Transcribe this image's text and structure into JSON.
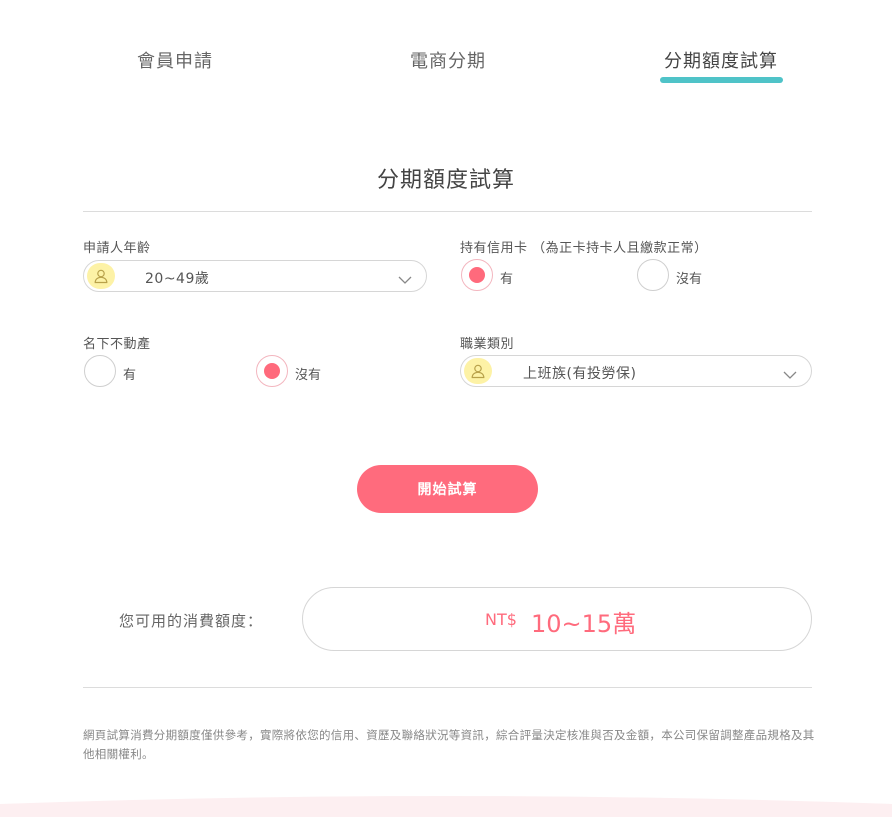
{
  "tabs": [
    {
      "label": "會員申請",
      "active": false
    },
    {
      "label": "電商分期",
      "active": false
    },
    {
      "label": "分期額度試算",
      "active": true
    }
  ],
  "page_title": "分期額度試算",
  "form": {
    "age": {
      "label": "申請人年齡",
      "value": "20~49歲",
      "icon": "user-icon"
    },
    "credit_card": {
      "label": "持有信用卡 （為正卡持卡人且繳款正常）",
      "options": [
        {
          "label": "有",
          "selected": true
        },
        {
          "label": "沒有",
          "selected": false
        }
      ]
    },
    "real_estate": {
      "label": "名下不動產",
      "options": [
        {
          "label": "有",
          "selected": false
        },
        {
          "label": "沒有",
          "selected": true
        }
      ]
    },
    "occupation": {
      "label": "職業類別",
      "value": "上班族(有投勞保)",
      "icon": "user-icon"
    }
  },
  "start_button": "開始試算",
  "result": {
    "label": "您可用的消費額度：",
    "currency": "NT$",
    "value": "10~15萬"
  },
  "disclaimer": "網頁試算消費分期額度僅供參考，實際將依您的信用、資歷及聯絡狀況等資訊，綜合評量決定核准與否及金額，本公司保留調整產品規格及其他相關權利。",
  "colors": {
    "accent_pink": "#ff6b7d",
    "tab_underline": "#4fc3c8",
    "avatar_bg": "#fdf2a6"
  }
}
